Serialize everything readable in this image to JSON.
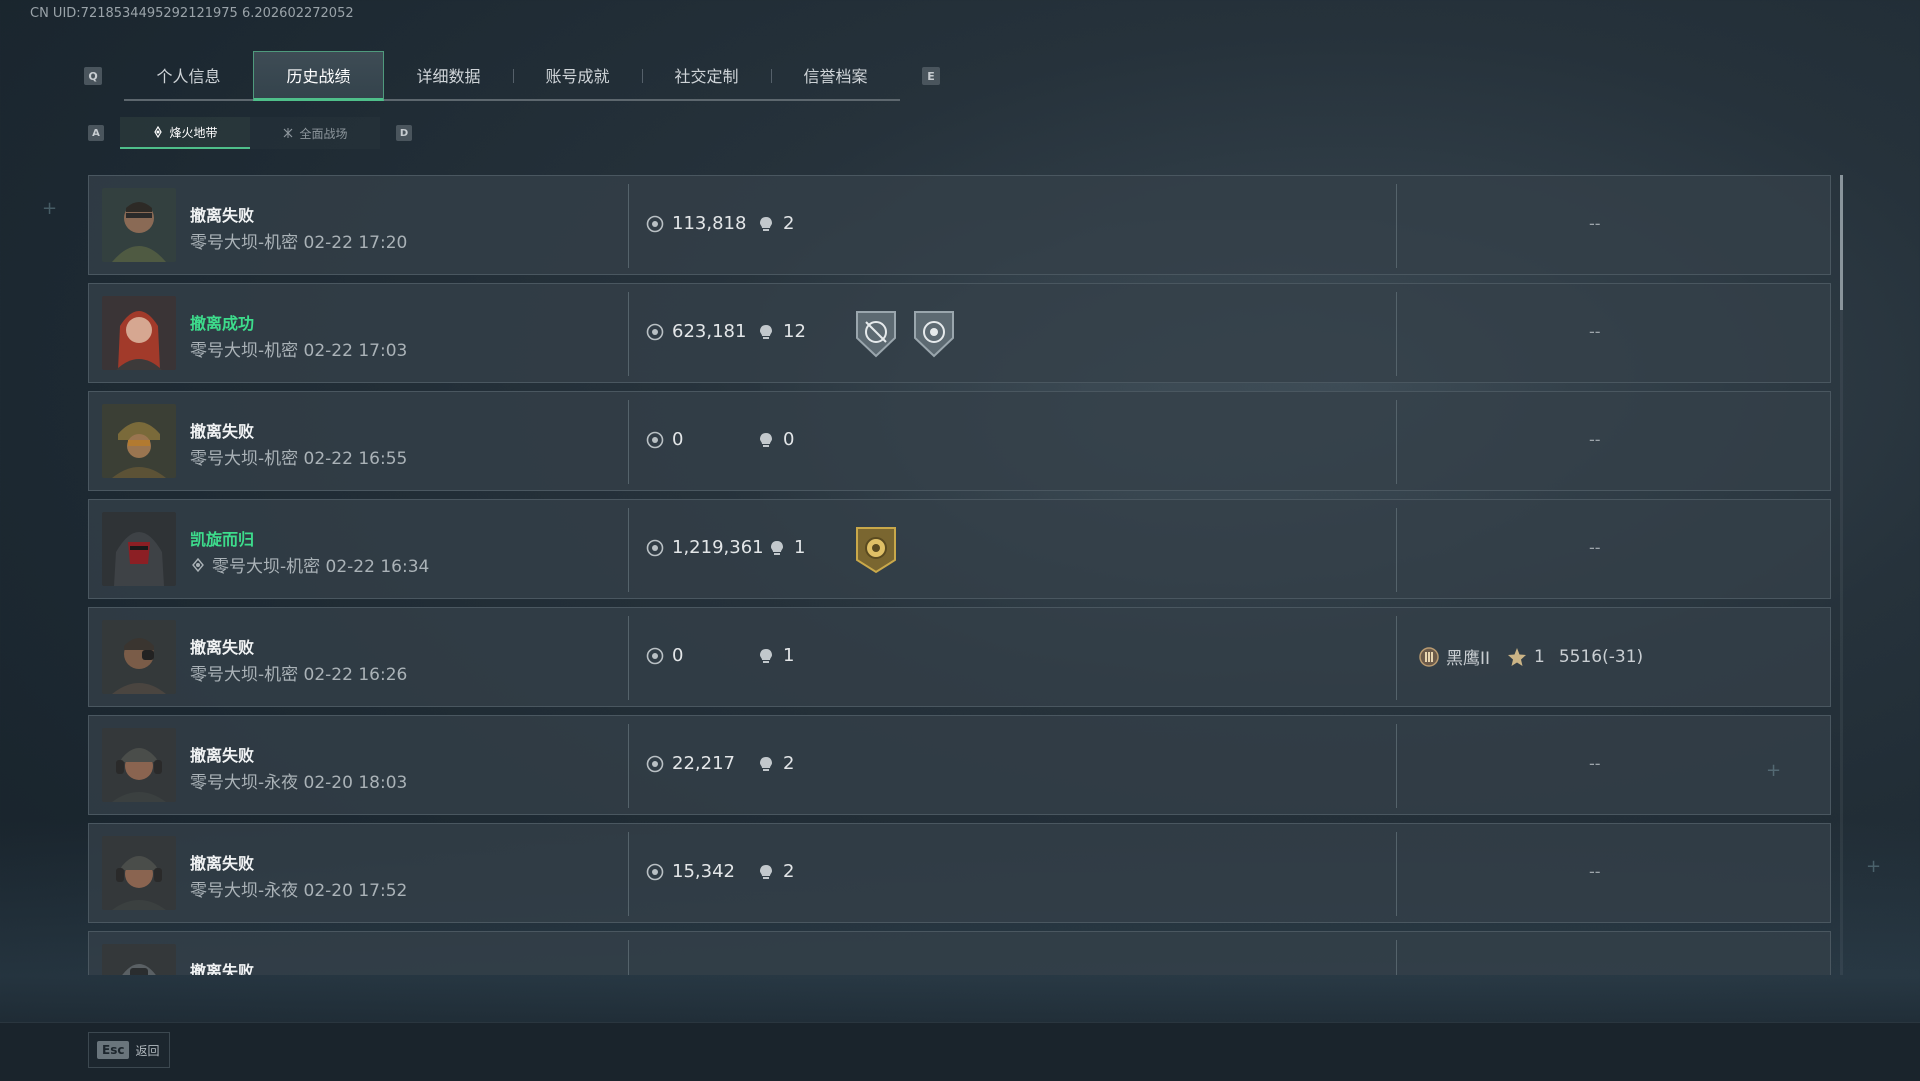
{
  "uid_text": "CN UID:7218534495292121975 6.202602272052",
  "header": {
    "left_key": "Q",
    "right_key": "E",
    "tabs": [
      {
        "label": "个人信息"
      },
      {
        "label": "历史战绩"
      },
      {
        "label": "详细数据"
      },
      {
        "label": "账号成就"
      },
      {
        "label": "社交定制"
      },
      {
        "label": "信誉档案"
      }
    ],
    "active_tab_index": 1
  },
  "subtabs": {
    "left_key": "A",
    "right_key": "D",
    "items": [
      {
        "label": "烽火地带",
        "icon": "flame-zone-icon"
      },
      {
        "label": "全面战场",
        "icon": "battlefield-icon"
      }
    ],
    "active_index": 0
  },
  "records": [
    {
      "status": "撤离失败",
      "success": false,
      "meta": "零号大坝-机密 02-22 17:20",
      "value": "113,818",
      "kills": "2",
      "badges": [],
      "rank": "--",
      "avatar": "soldier-glasses"
    },
    {
      "status": "撤离成功",
      "success": true,
      "meta": "零号大坝-机密 02-22 17:03",
      "value": "623,181",
      "kills": "12",
      "badges": [
        "crosshair-shield-badge",
        "skull-shield-badge"
      ],
      "rank": "--",
      "avatar": "red-hair-woman"
    },
    {
      "status": "撤离失败",
      "success": false,
      "meta": "零号大坝-机密 02-22 16:55",
      "value": "0",
      "kills": "0",
      "badges": [],
      "rank": "--",
      "avatar": "camo-helmet-soldier"
    },
    {
      "status": "凯旋而归",
      "success": true,
      "meta": "零号大坝-机密 02-22 16:34",
      "value": "1,219,361",
      "kills": "1",
      "badges": [
        "gold-target-badge"
      ],
      "rank": "--",
      "avatar": "red-mask-hood",
      "zone_icon": true
    },
    {
      "status": "撤离失败",
      "success": false,
      "meta": "零号大坝-机密 02-22 16:26",
      "value": "0",
      "kills": "1",
      "badges": [],
      "rank": "",
      "rank_info": {
        "tier": "黑鹰II",
        "stars": "1",
        "score": "5516(-31)"
      },
      "avatar": "night-vision-soldier"
    },
    {
      "status": "撤离失败",
      "success": false,
      "meta": "零号大坝-永夜 02-20 18:03",
      "value": "22,217",
      "kills": "2",
      "badges": [],
      "rank": "--",
      "avatar": "headset-soldier"
    },
    {
      "status": "撤离失败",
      "success": false,
      "meta": "零号大坝-永夜 02-20 17:52",
      "value": "15,342",
      "kills": "2",
      "badges": [],
      "rank": "--",
      "avatar": "headset-soldier"
    },
    {
      "status": "撤离失败",
      "success": false,
      "meta": "",
      "value": "",
      "kills": "",
      "badges": [],
      "rank": "",
      "avatar": "gasmask-soldier"
    }
  ],
  "footer": {
    "esc_key": "Esc",
    "esc_label": "返回"
  },
  "colors": {
    "accent_green": "#3ddc8c",
    "tab_underline": "#4fbf8a"
  }
}
